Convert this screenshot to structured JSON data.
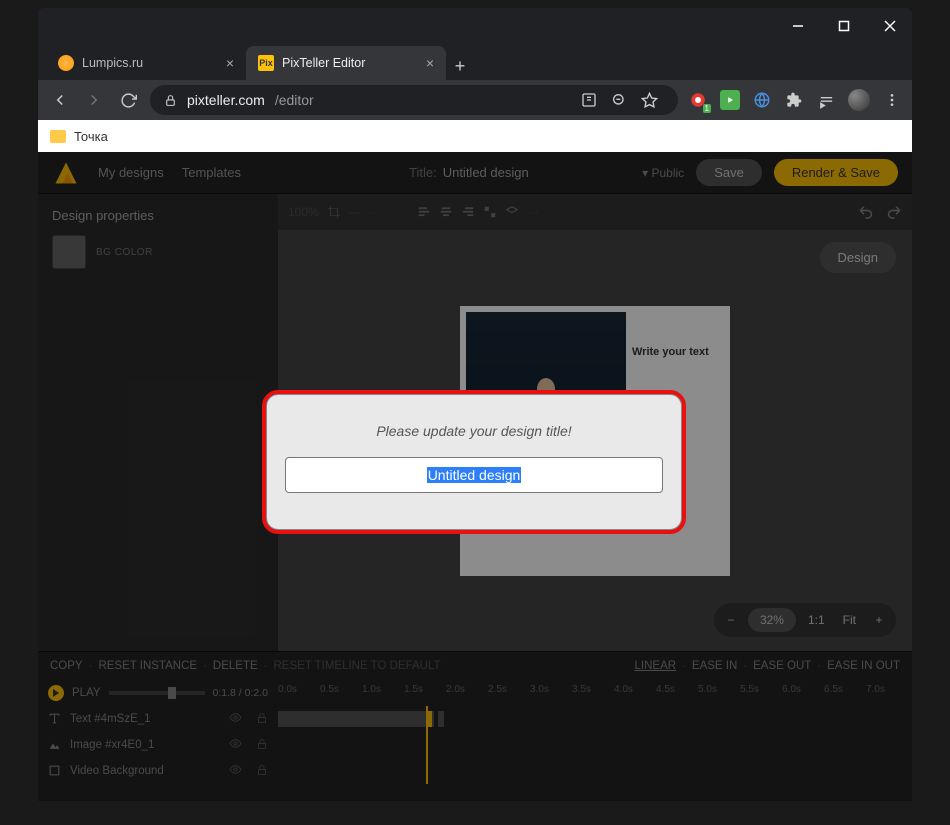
{
  "browser": {
    "tabs": [
      {
        "title": "Lumpics.ru",
        "active": false
      },
      {
        "title": "PixTeller Editor",
        "active": true,
        "favtext": "Pix"
      }
    ],
    "url_host": "pixteller.com",
    "url_path": "/editor",
    "bookmark": "Точка"
  },
  "app": {
    "nav": {
      "mydesigns": "My designs",
      "templates": "Templates"
    },
    "title_label": "Title:",
    "title_value": "Untitled design",
    "visibility": "Public",
    "save": "Save",
    "render": "Render & Save",
    "toolbar_zoom": "100%"
  },
  "sidebar": {
    "heading": "Design properties",
    "bgcolor_label": "BG COLOR"
  },
  "canvas": {
    "design_btn": "Design",
    "placeholder": "Write your text",
    "zoom": {
      "value": "32%",
      "ratio": "1:1",
      "fit": "Fit"
    }
  },
  "timeline": {
    "ops": {
      "copy": "COPY",
      "reset_inst": "RESET INSTANCE",
      "delete": "DELETE",
      "reset_tl": "RESET TIMELINE TO DEFAULT",
      "linear": "LINEAR",
      "easein": "EASE IN",
      "easeout": "EASE OUT",
      "easeinout": "EASE IN OUT"
    },
    "play": "PLAY",
    "time": "0:1.8 / 0:2.0",
    "ticks": [
      "0.0s",
      "0.5s",
      "1.0s",
      "1.5s",
      "2.0s",
      "2.5s",
      "3.0s",
      "3.5s",
      "4.0s",
      "4.5s",
      "5.0s",
      "5.5s",
      "6.0s",
      "6.5s",
      "7.0s"
    ],
    "layers": [
      {
        "name": "Text #4mSzE_1",
        "icon": "text"
      },
      {
        "name": "Image #xr4E0_1",
        "icon": "image"
      },
      {
        "name": "Video Background",
        "icon": "video"
      }
    ]
  },
  "modal": {
    "message": "Please update your design title!",
    "value": "Untitled design"
  }
}
